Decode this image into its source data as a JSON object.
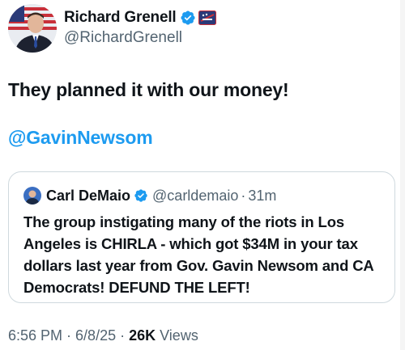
{
  "author": {
    "name": "Richard Grenell",
    "handle": "@RichardGrenell",
    "avatar_icon": "profile-photo-icon",
    "verified_icon": "verified-badge-icon",
    "affiliation_icon": "affiliation-badge-icon"
  },
  "tweet": {
    "text": "They planned it with our money!",
    "mention": "@GavinNewsom"
  },
  "quoted_tweet": {
    "name": "Carl DeMaio",
    "handle": "@carldemaio",
    "separator": "·",
    "time": "31m",
    "text": "The group instigating many of the riots in Los Angeles is CHIRLA - which got $34M in your tax dollars last year from Gov. Gavin Newsom and CA Democrats! DEFUND THE LEFT!"
  },
  "footer": {
    "time": "6:56 PM",
    "date": "6/8/25",
    "separator": "·",
    "views_count": "26K",
    "views_label": "Views"
  },
  "colors": {
    "accent": "#1d9bf0",
    "text": "#0f1419",
    "secondary": "#536471",
    "border": "#cfd9de"
  }
}
